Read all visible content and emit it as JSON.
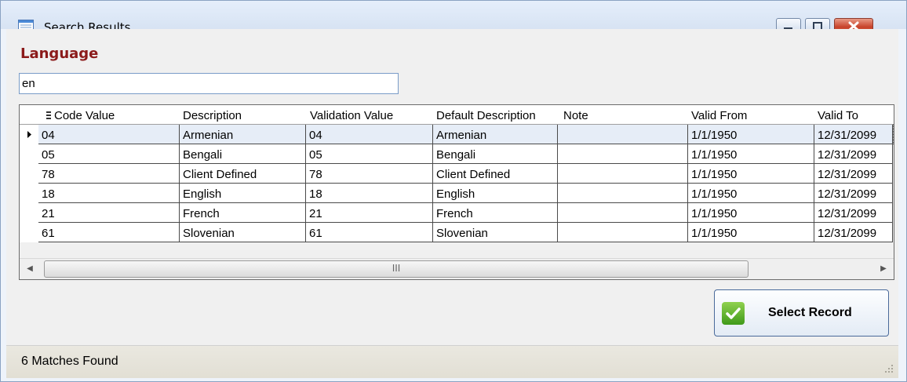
{
  "window": {
    "title": "Search Results",
    "icon": "form-window-icon"
  },
  "caption_buttons": {
    "minimize_icon": "minimize-icon",
    "maximize_icon": "maximize-icon",
    "close_icon": "close-icon"
  },
  "search": {
    "label": "Language",
    "value": "en"
  },
  "grid": {
    "columns": [
      "Code Value",
      "Description",
      "Validation Value",
      "Default Description",
      "Note",
      "Valid From",
      "Valid To"
    ],
    "rows": [
      [
        "04",
        "Armenian",
        "04",
        "Armenian",
        "",
        "1/1/1950",
        "12/31/2099"
      ],
      [
        "05",
        "Bengali",
        "05",
        "Bengali",
        "",
        "1/1/1950",
        "12/31/2099"
      ],
      [
        "78",
        "Client Defined",
        "78",
        "Client Defined",
        "",
        "1/1/1950",
        "12/31/2099"
      ],
      [
        "18",
        "English",
        "18",
        "English",
        "",
        "1/1/1950",
        "12/31/2099"
      ],
      [
        "21",
        "French",
        "21",
        "French",
        "",
        "1/1/1950",
        "12/31/2099"
      ],
      [
        "61",
        "Slovenian",
        "61",
        "Slovenian",
        "",
        "1/1/1950",
        "12/31/2099"
      ]
    ],
    "selected_row": 0,
    "scroll_thumb_glyph": "III"
  },
  "actions": {
    "select_label": "Select Record"
  },
  "status": {
    "text": "6 Matches Found"
  },
  "colors": {
    "label_accent": "#8b1a1a",
    "select_icon_green": "#5fb52c"
  }
}
